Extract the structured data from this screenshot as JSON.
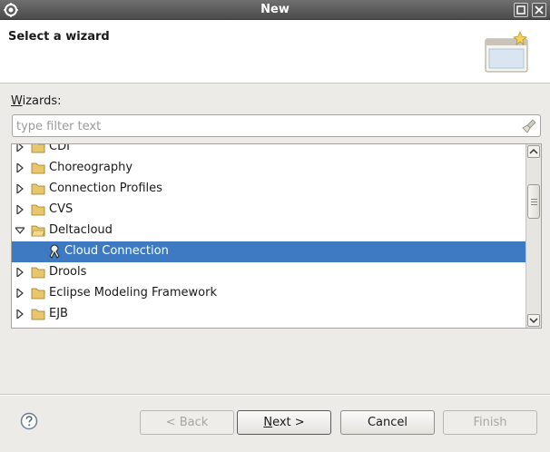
{
  "window": {
    "title": "New"
  },
  "banner": {
    "title": "Select a wizard"
  },
  "wizards_label": {
    "mnemonic": "W",
    "rest": "izards:"
  },
  "filter": {
    "placeholder": "type filter text",
    "value": ""
  },
  "tree": {
    "items": [
      {
        "label": "CDI",
        "expanded": false
      },
      {
        "label": "Choreography",
        "expanded": false
      },
      {
        "label": "Connection Profiles",
        "expanded": false
      },
      {
        "label": "CVS",
        "expanded": false
      },
      {
        "label": "Deltacloud",
        "expanded": true
      },
      {
        "label": "Cloud Connection",
        "selected": true
      },
      {
        "label": "Drools",
        "expanded": false
      },
      {
        "label": "Eclipse Modeling Framework",
        "expanded": false
      },
      {
        "label": "EJB",
        "expanded": false
      }
    ]
  },
  "footer": {
    "back_label": "< Back",
    "next_mnemonic": "N",
    "next_rest": "ext >",
    "cancel_label": "Cancel",
    "finish_label": "Finish"
  },
  "colors": {
    "selection": "#3d7ac1",
    "titlebar": "#4b4b4b",
    "folder": "#e8c66a"
  }
}
